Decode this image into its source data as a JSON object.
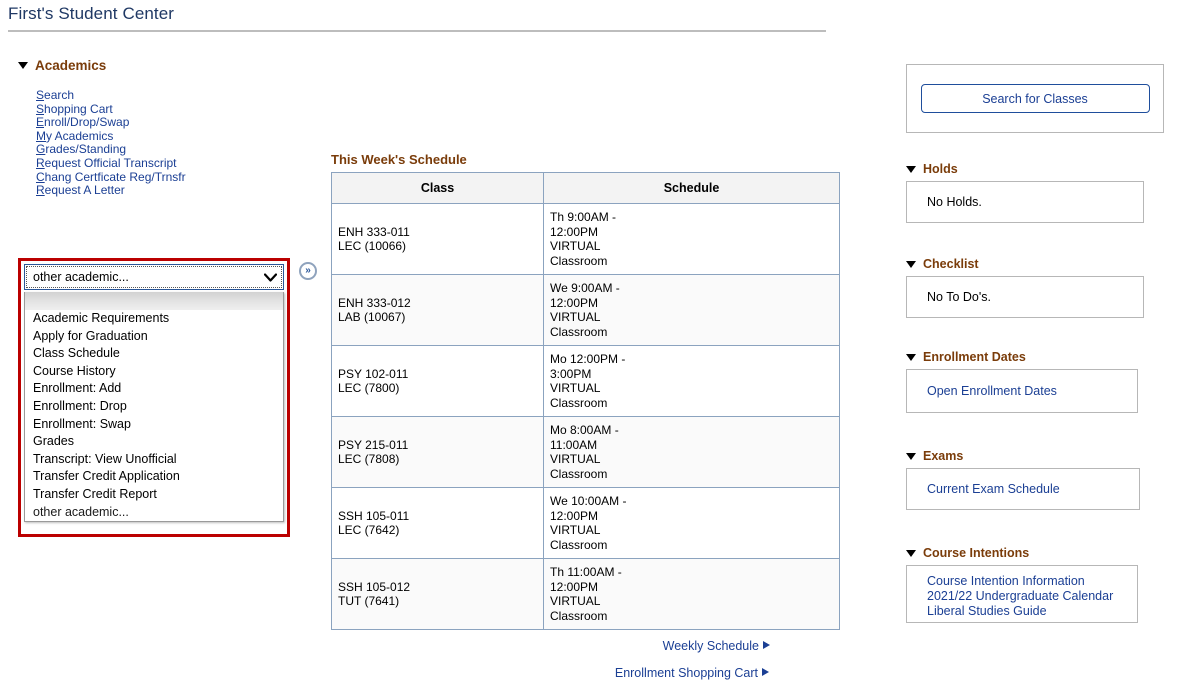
{
  "header": {
    "title": "First's Student Center"
  },
  "academics": {
    "section_label": "Academics",
    "links": [
      {
        "label": "Search",
        "accesskey": "S",
        "rest": "earch"
      },
      {
        "label": "Shopping Cart",
        "accesskey": "S",
        "rest": "hopping Cart"
      },
      {
        "label": "Enroll/Drop/Swap",
        "accesskey": "E",
        "rest": "nroll/Drop/Swap"
      },
      {
        "label": "My Academics",
        "accesskey": "M",
        "rest": "y Academics"
      },
      {
        "label": "Grades/Standing",
        "accesskey": "G",
        "rest": "rades/Standing"
      },
      {
        "label": "Request Official Transcript",
        "accesskey": "R",
        "rest": "equest Official Transcript"
      },
      {
        "label": "Chang Certficate Reg/Trnsfr",
        "accesskey": "C",
        "rest": "hang Certficate Reg/Trnsfr"
      },
      {
        "label": "Request A Letter",
        "accesskey": "R",
        "rest": "equest A Letter"
      }
    ]
  },
  "dropdown": {
    "selected": "other academic...",
    "caret_icon": "chevron-down-icon",
    "expand_icon": "double-chevron-right-icon",
    "options": [
      "",
      "Academic Requirements",
      "Apply for Graduation",
      "Class Schedule",
      "Course History",
      "Enrollment: Add",
      "Enrollment: Drop",
      "Enrollment: Swap",
      "Grades",
      "Transcript: View Unofficial",
      "Transfer Credit Application",
      "Transfer Credit Report",
      "other academic..."
    ],
    "highlight_color": "#d2d2d2",
    "frame_color": "#bb0000"
  },
  "schedule": {
    "title": "This Week's Schedule",
    "columns": [
      "Class",
      "Schedule"
    ],
    "rows": [
      {
        "class_line1": "ENH 333-011",
        "class_line2": "LEC (10066)",
        "time": "Th 9:00AM -",
        "time2": "12:00PM",
        "room1": "VIRTUAL",
        "room2": "Classroom"
      },
      {
        "class_line1": "ENH 333-012",
        "class_line2": "LAB (10067)",
        "time": "We 9:00AM -",
        "time2": "12:00PM",
        "room1": "VIRTUAL",
        "room2": "Classroom"
      },
      {
        "class_line1": "PSY 102-011",
        "class_line2": "LEC (7800)",
        "time": "Mo 12:00PM -",
        "time2": "3:00PM",
        "room1": "VIRTUAL",
        "room2": "Classroom"
      },
      {
        "class_line1": "PSY 215-011",
        "class_line2": "LEC (7808)",
        "time": "Mo 8:00AM -",
        "time2": "11:00AM",
        "room1": "VIRTUAL",
        "room2": "Classroom"
      },
      {
        "class_line1": "SSH 105-011",
        "class_line2": "LEC (7642)",
        "time": "We 10:00AM -",
        "time2": "12:00PM",
        "room1": "VIRTUAL",
        "room2": "Classroom"
      },
      {
        "class_line1": "SSH 105-012",
        "class_line2": "TUT (7641)",
        "time": "Th 11:00AM -",
        "time2": "12:00PM",
        "room1": "VIRTUAL",
        "room2": "Classroom"
      }
    ],
    "weekly_schedule_link": "Weekly Schedule",
    "shopping_cart_link": "Enrollment Shopping Cart"
  },
  "sidebar": {
    "search_button": "Search for Classes",
    "holds": {
      "title": "Holds",
      "text": "No Holds."
    },
    "checklist": {
      "title": "Checklist",
      "text": "No To Do's."
    },
    "enrollment_dates": {
      "title": "Enrollment Dates",
      "link": "Open Enrollment Dates"
    },
    "exams": {
      "title": "Exams",
      "link": "Current Exam Schedule"
    },
    "course_intentions": {
      "title": "Course Intentions",
      "links": [
        "Course Intention Information",
        "2021/22 Undergraduate Calendar",
        "Liberal Studies Guide"
      ]
    }
  },
  "colors": {
    "title": "#1f3864",
    "section_heading": "#7a3c0a",
    "link": "#1b3f94",
    "table_border": "#8ba3bf",
    "panel_border": "#b7b7b7",
    "focus_frame": "#bb0000"
  }
}
